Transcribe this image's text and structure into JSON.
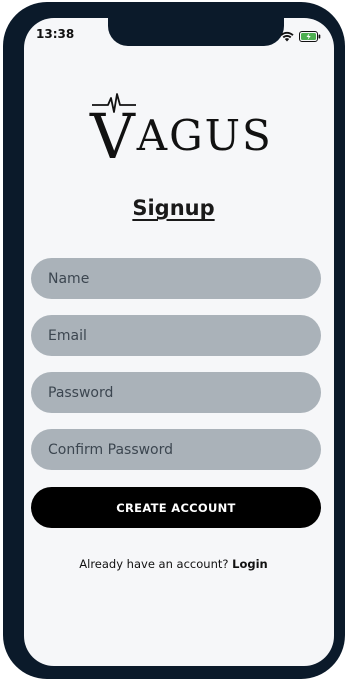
{
  "status_bar": {
    "time": "13:38",
    "icons": [
      "wifi-icon",
      "battery-charging-icon"
    ]
  },
  "brand": {
    "logo_first_letter": "V",
    "logo_rest": "AGUS"
  },
  "page": {
    "title": "Signup"
  },
  "form": {
    "name_placeholder": "Name",
    "email_placeholder": "Email",
    "password_placeholder": "Password",
    "confirm_password_placeholder": "Confirm Password",
    "submit_label": "CREATE ACCOUNT"
  },
  "footer": {
    "prompt": "Already have an account?",
    "login_label": "Login"
  },
  "colors": {
    "frame": "#0b1a2a",
    "screen_bg": "#f6f7f9",
    "field_bg": "#aab2b9",
    "button_bg": "#000000",
    "battery_fill": "#4caf50"
  }
}
